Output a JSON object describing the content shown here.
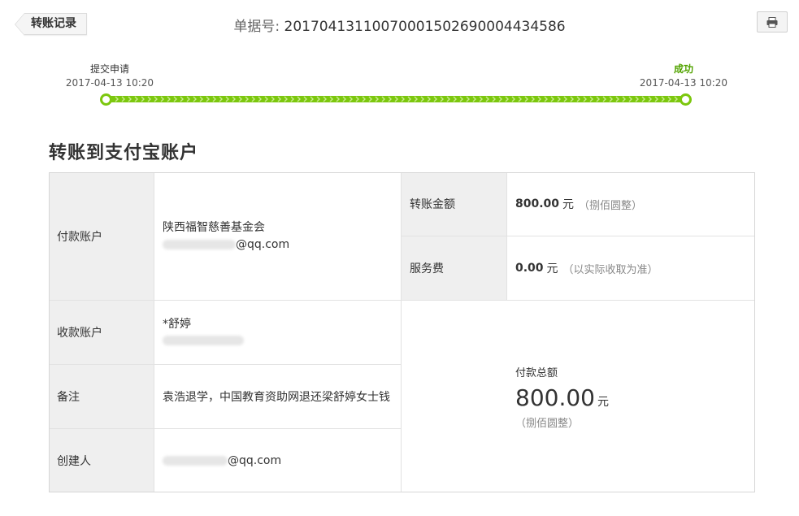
{
  "header": {
    "back_label": "转账记录",
    "order_no_label": "单据号:",
    "order_no_value": "2017041311007000150269000443458​6"
  },
  "progress": {
    "steps": [
      {
        "name": "提交申请",
        "time": "2017-04-13 10:20"
      },
      {
        "name": "成功",
        "time": "2017-04-13 10:20"
      }
    ],
    "accent_color": "#7cc70e"
  },
  "section": {
    "title": "转账到支付宝账户"
  },
  "table": {
    "payer_label": "付款账户",
    "payer_name": "陕西福智慈善基金会",
    "payer_email_suffix": "@qq.com",
    "payee_label": "收款账户",
    "payee_name": "*舒婷",
    "memo_label": "备注",
    "memo_value": "袁浩退学，中国教育资助网退还梁舒婷女士钱",
    "creator_label": "创建人",
    "creator_email_suffix": "@qq.com",
    "amount_label": "转账金额",
    "amount_value": "800.00",
    "amount_unit": "元",
    "amount_words": "（捌佰圆整）",
    "fee_label": "服务费",
    "fee_value": "0.00",
    "fee_unit": "元",
    "fee_note": "（以实际收取为准）",
    "total_label": "付款总额",
    "total_value": "800.00",
    "total_unit": "元",
    "total_words": "（捌佰圆整）"
  }
}
